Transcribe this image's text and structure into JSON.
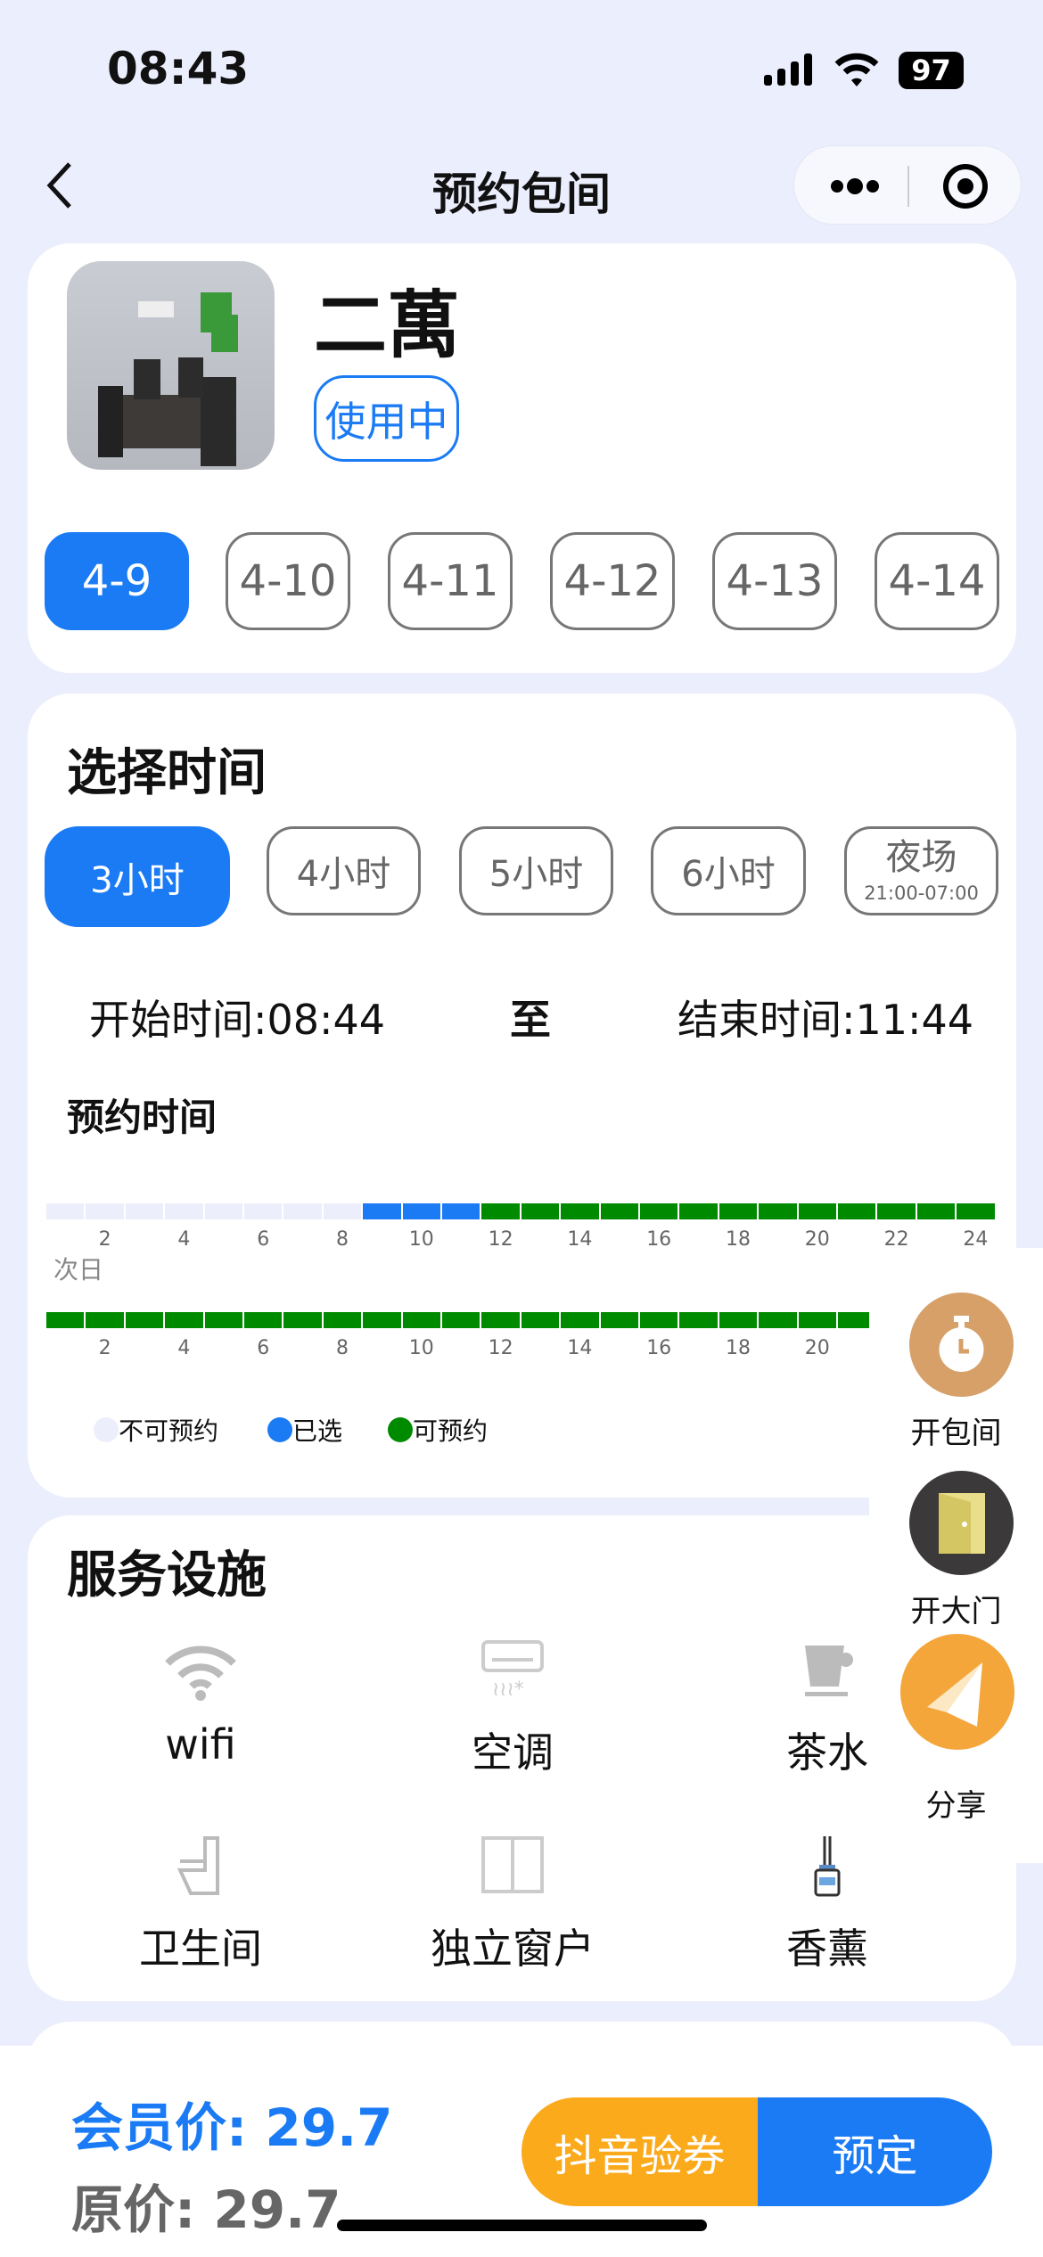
{
  "status_bar": {
    "time": "08:43",
    "battery": "97"
  },
  "nav": {
    "title": "预约包间",
    "back_icon": "chevron-left-icon",
    "more_icon": "more-dots-icon",
    "capsule_icon": "target-icon"
  },
  "room": {
    "name": "二萬",
    "status": "使用中",
    "accent": "#1a7bf5"
  },
  "dates": [
    {
      "label": "4-9",
      "active": true
    },
    {
      "label": "4-10"
    },
    {
      "label": "4-11"
    },
    {
      "label": "4-12"
    },
    {
      "label": "4-13"
    },
    {
      "label": "4-14"
    }
  ],
  "time_section": {
    "title": "选择时间",
    "durations": [
      {
        "label": "3小时",
        "active": true
      },
      {
        "label": "4小时"
      },
      {
        "label": "5小时"
      },
      {
        "label": "6小时"
      },
      {
        "label": "夜场",
        "sub": "21:00-07:00"
      }
    ],
    "start": "开始时间:08:44",
    "to": "至",
    "end": "结束时间:11:44",
    "booking_title": "预约时间",
    "next_day": "次日",
    "today_slots": [
      "u",
      "u",
      "u",
      "u",
      "u",
      "u",
      "u",
      "u",
      "s",
      "s",
      "s",
      "a",
      "a",
      "a",
      "a",
      "a",
      "a",
      "a",
      "a",
      "a",
      "a",
      "a",
      "a",
      "a"
    ],
    "today_ticks": [
      "2",
      "4",
      "6",
      "8",
      "10",
      "12",
      "14",
      "16",
      "18",
      "20",
      "22",
      "24"
    ],
    "next_slots": [
      "a",
      "a",
      "a",
      "a",
      "a",
      "a",
      "a",
      "a",
      "a",
      "a",
      "a",
      "a",
      "a",
      "a",
      "a",
      "a",
      "a",
      "a",
      "a",
      "a",
      "a"
    ],
    "next_ticks": [
      "2",
      "4",
      "6",
      "8",
      "10",
      "12",
      "14",
      "16",
      "18",
      "20"
    ],
    "legend": [
      {
        "label": "不可预约",
        "color": "#eceffb"
      },
      {
        "label": "已选",
        "color": "#1a7bf5"
      },
      {
        "label": "可预约",
        "color": "#008a00"
      }
    ]
  },
  "facilities": {
    "title": "服务设施",
    "items": [
      {
        "label": "wifi",
        "icon": "wifi-icon"
      },
      {
        "label": "空调",
        "icon": "air-conditioner-icon"
      },
      {
        "label": "茶水",
        "icon": "tea-cup-icon"
      },
      {
        "label": "卫生间",
        "icon": "toilet-icon"
      },
      {
        "label": "独立窗户",
        "icon": "window-icon"
      },
      {
        "label": "香薰",
        "icon": "aroma-diffuser-icon"
      }
    ]
  },
  "float": {
    "open_room": "开包间",
    "open_gate": "开大门",
    "share": "分享"
  },
  "footer": {
    "member_price": "会员价: 29.7",
    "original_price": "原价: 29.7",
    "douyin": "抖音验券",
    "book": "预定",
    "orange": "#fbaa1c"
  }
}
